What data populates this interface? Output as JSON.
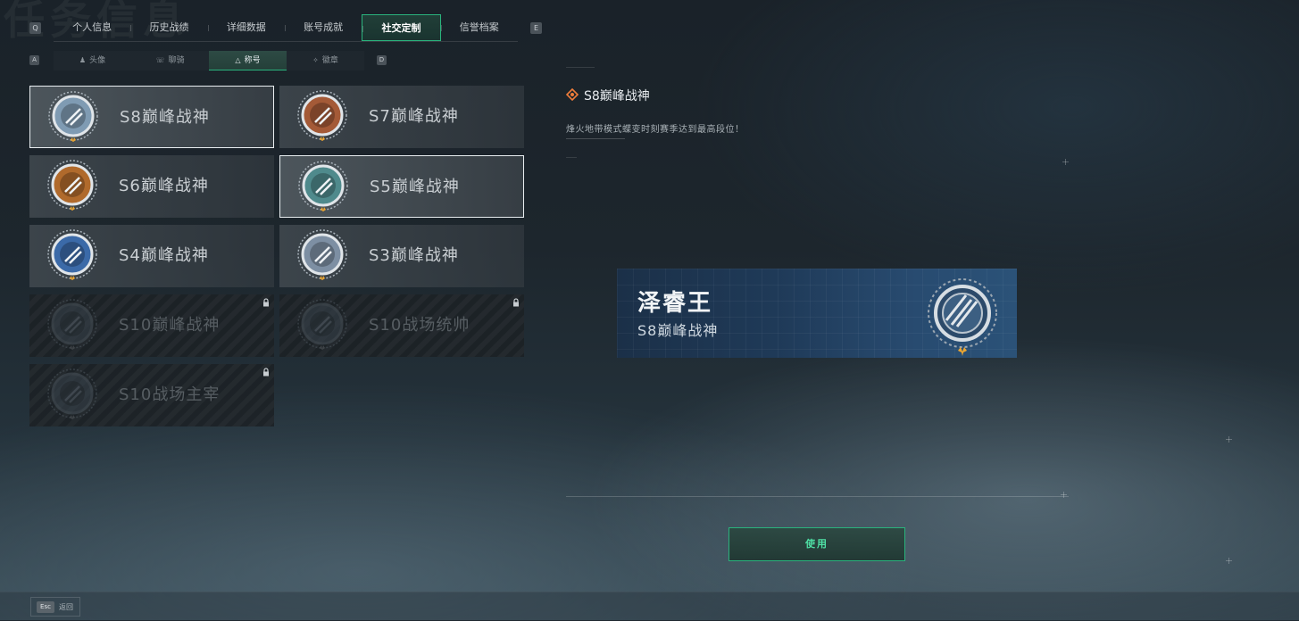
{
  "background": {
    "watermark": "任务信息"
  },
  "top_tabs": {
    "left_key": "Q",
    "right_key": "E",
    "items": [
      {
        "label": "个人信息",
        "active": false
      },
      {
        "label": "历史战绩",
        "active": false
      },
      {
        "label": "详细数据",
        "active": false
      },
      {
        "label": "账号成就",
        "active": false
      },
      {
        "label": "社交定制",
        "active": true
      },
      {
        "label": "信誉档案",
        "active": false
      }
    ]
  },
  "sub_tabs": {
    "left_key": "A",
    "right_key": "D",
    "items": [
      {
        "label": "头像",
        "icon": "person-icon",
        "active": false
      },
      {
        "label": "聊骑",
        "icon": "chat-icon",
        "active": false
      },
      {
        "label": "称号",
        "icon": "triangle-icon",
        "active": true
      },
      {
        "label": "徽章",
        "icon": "emblem-icon",
        "active": false
      }
    ]
  },
  "titles": [
    {
      "name": "S8巅峰战神",
      "locked": false,
      "selected": true,
      "emblem": "s8-emblem-icon",
      "color": "#7f9bb3"
    },
    {
      "name": "S7巅峰战神",
      "locked": false,
      "selected": false,
      "emblem": "s7-emblem-icon",
      "color": "#a45a37"
    },
    {
      "name": "S6巅峰战神",
      "locked": false,
      "selected": false,
      "emblem": "s6-emblem-icon",
      "color": "#b06a2c"
    },
    {
      "name": "S5巅峰战神",
      "locked": false,
      "selected": true,
      "emblem": "s5-emblem-icon",
      "color": "#4f8a8c"
    },
    {
      "name": "S4巅峰战神",
      "locked": false,
      "selected": false,
      "emblem": "s4-emblem-icon",
      "color": "#3b6aa8"
    },
    {
      "name": "S3巅峰战神",
      "locked": false,
      "selected": false,
      "emblem": "s3-emblem-icon",
      "color": "#7d8fa3"
    },
    {
      "name": "S10巅峰战神",
      "locked": true,
      "selected": false,
      "emblem": "s10-peak-emblem-icon",
      "color": "#39444d"
    },
    {
      "name": "S10战场统帅",
      "locked": true,
      "selected": false,
      "emblem": "s10-commander-emblem-icon",
      "color": "#39444d"
    },
    {
      "name": "S10战场主宰",
      "locked": true,
      "selected": false,
      "emblem": "s10-dominator-emblem-icon",
      "color": "#39444d"
    }
  ],
  "detail": {
    "title": "S8巅峰战神",
    "description": "烽火地带模式蝶变时刻赛季达到最高段位！"
  },
  "name_card": {
    "player_name": "泽睿王",
    "title": "S8巅峰战神"
  },
  "use_button": {
    "label": "使用"
  },
  "footer": {
    "key": "Esc",
    "label": "返回"
  },
  "colors": {
    "accent": "#2ab37d",
    "selected_border": "#e9eef1",
    "star": "#f0a830"
  }
}
